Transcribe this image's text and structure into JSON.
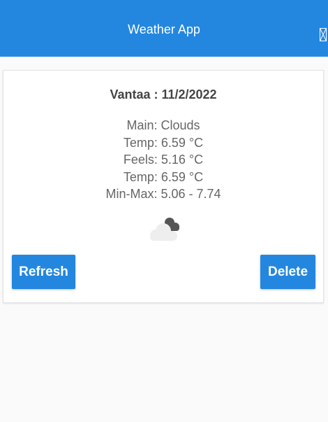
{
  "header": {
    "title": "Weather App",
    "menu_icon": "broken-image-icon",
    "background_color": "#2387e0"
  },
  "card": {
    "title": "Vantaa : 11/2/2022",
    "lines": [
      "Main: Clouds",
      "Temp: 6.59 °C",
      "Feels: 5.16 °C",
      "Temp: 6.59 °C",
      "Min-Max: 5.06 - 7.74"
    ],
    "weather_icon": "broken-clouds-icon",
    "refresh_label": "Refresh",
    "delete_label": "Delete"
  }
}
